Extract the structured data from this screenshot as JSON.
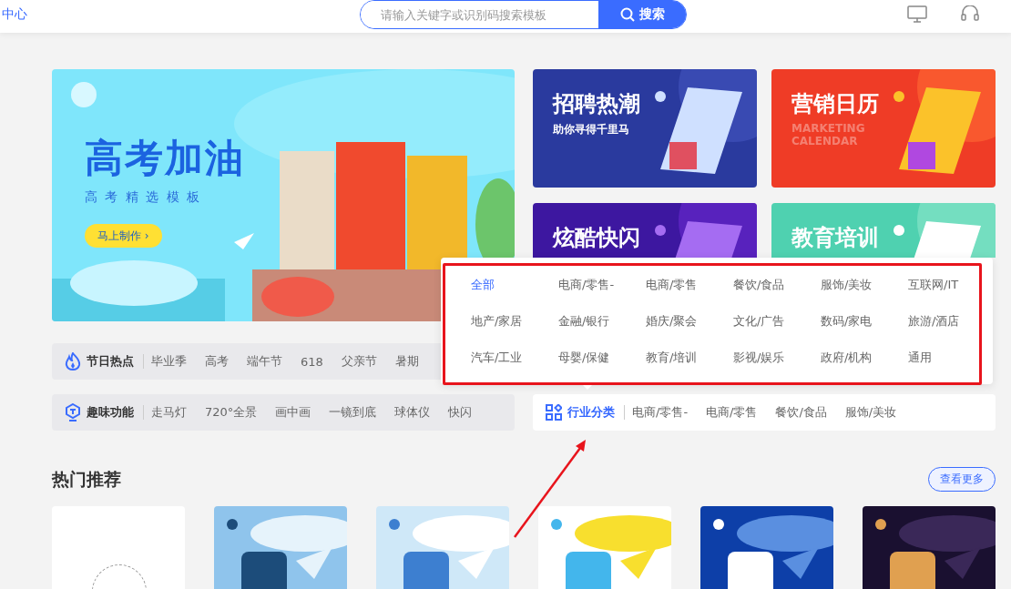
{
  "header": {
    "link": "中心",
    "search": {
      "placeholder": "请输入关键字或识别码搜索模板",
      "button": "搜索"
    }
  },
  "banner": {
    "title": "高考加油",
    "subtitle": "高 考 精 选 模 板",
    "button": "马上制作 ›"
  },
  "promo_cards": [
    {
      "kind": "job",
      "title": "招聘热潮",
      "subtitle": "助你寻得千里马"
    },
    {
      "kind": "calendar",
      "title": "营销日历",
      "subtitle": "MARKETING CALENDAR"
    },
    {
      "kind": "flash",
      "title": "炫酷快闪"
    },
    {
      "kind": "education",
      "title": "教育培训"
    }
  ],
  "tag_bars": [
    {
      "kind": "festival",
      "label": "节日热点",
      "items": [
        "毕业季",
        "高考",
        "端午节",
        "618",
        "父亲节",
        "暑期"
      ]
    },
    {
      "kind": "fun",
      "label": "趣味功能",
      "items": [
        "走马灯",
        "720°全景",
        "画中画",
        "一镜到底",
        "球体仪",
        "快闪"
      ]
    },
    {
      "kind": "industry",
      "label": "行业分类",
      "items": [
        "电商/零售-",
        "电商/零售",
        "餐饮/食品",
        "服饰/美妆"
      ]
    }
  ],
  "industry_dropdown": [
    {
      "label": "全部",
      "selected": true
    },
    {
      "label": "电商/零售-",
      "selected": false
    },
    {
      "label": "电商/零售",
      "selected": false
    },
    {
      "label": "餐饮/食品",
      "selected": false
    },
    {
      "label": "服饰/美妆",
      "selected": false
    },
    {
      "label": "互联网/IT",
      "selected": false
    },
    {
      "label": "地产/家居",
      "selected": false
    },
    {
      "label": "金融/银行",
      "selected": false
    },
    {
      "label": "婚庆/聚会",
      "selected": false
    },
    {
      "label": "文化/广告",
      "selected": false
    },
    {
      "label": "数码/家电",
      "selected": false
    },
    {
      "label": "旅游/酒店",
      "selected": false
    },
    {
      "label": "汽车/工业",
      "selected": false
    },
    {
      "label": "母婴/保健",
      "selected": false
    },
    {
      "label": "教育/培训",
      "selected": false
    },
    {
      "label": "影视/娱乐",
      "selected": false
    },
    {
      "label": "政府/机构",
      "selected": false
    },
    {
      "label": "通用",
      "selected": false
    }
  ],
  "hot": {
    "title": "热门推荐",
    "more": "查看更多",
    "cards": [
      {
        "kind": "blank"
      },
      {
        "kind": "picture"
      },
      {
        "kind": "picture"
      },
      {
        "kind": "picture"
      },
      {
        "kind": "picture"
      },
      {
        "kind": "picture"
      }
    ]
  }
}
